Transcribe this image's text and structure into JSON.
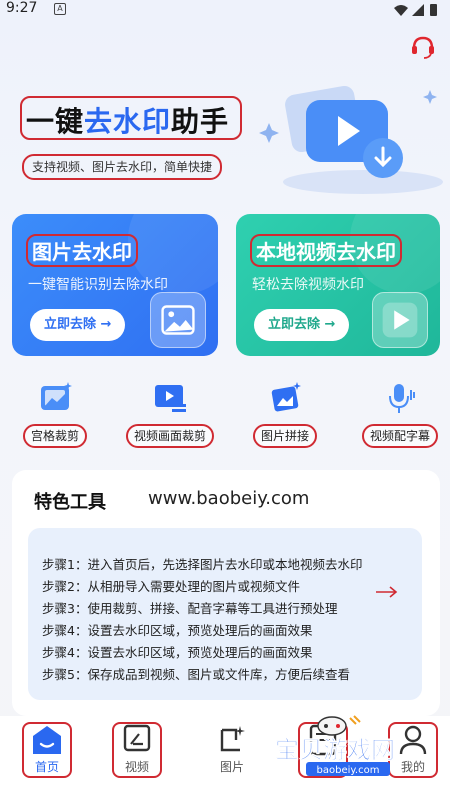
{
  "status": {
    "time": "9:27",
    "a_icon": "A"
  },
  "hero": {
    "title_part1": "一键",
    "title_part2": "去水印",
    "title_part3": "助手",
    "subtitle": "支持视频、图片去水印，简单快捷"
  },
  "cards": [
    {
      "title": "图片去水印",
      "desc": "一键智能识别去除水印",
      "button": "立即去除 →",
      "icon": "image-icon",
      "color": "#2f6ff2"
    },
    {
      "title": "本地视频去水印",
      "desc": "轻松去除视频水印",
      "button": "立即去除 →",
      "icon": "play-icon",
      "color": "#1fb79a"
    }
  ],
  "tools": [
    {
      "label": "宫格裁剪",
      "icon": "grid-crop-icon"
    },
    {
      "label": "视频画面裁剪",
      "icon": "video-crop-icon"
    },
    {
      "label": "图片拼接",
      "icon": "image-stitch-icon"
    },
    {
      "label": "视频配字幕",
      "icon": "microphone-icon"
    }
  ],
  "features": {
    "title": "特色工具",
    "site": "www.baobeiy.com",
    "steps": [
      "步骤1：进入首页后，先选择图片去水印或本地视频去水印",
      "步骤2：从相册导入需要处理的图片或视频文件",
      "步骤3：使用裁剪、拼接、配音字幕等工具进行预处理",
      "步骤4：设置去水印区域，预览处理后的画面效果",
      "步骤4：设置去水印区域，预览处理后的画面效果",
      "步骤5：保存成品到视频、图片或文件库，方便后续查看"
    ]
  },
  "tabs": [
    {
      "label": "首页",
      "icon": "home-icon",
      "active": true
    },
    {
      "label": "视频",
      "icon": "video-icon",
      "active": false
    },
    {
      "label": "图片",
      "icon": "image-icon",
      "active": false
    },
    {
      "label": "",
      "icon": "file-icon",
      "active": false
    },
    {
      "label": "我的",
      "icon": "user-icon",
      "active": false
    }
  ],
  "watermark": {
    "name": "宝贝游戏网",
    "url": "baobeiy.com"
  },
  "colors": {
    "accent": "#2a68f0",
    "highlight": "#d02a32",
    "green": "#1fb79a"
  }
}
